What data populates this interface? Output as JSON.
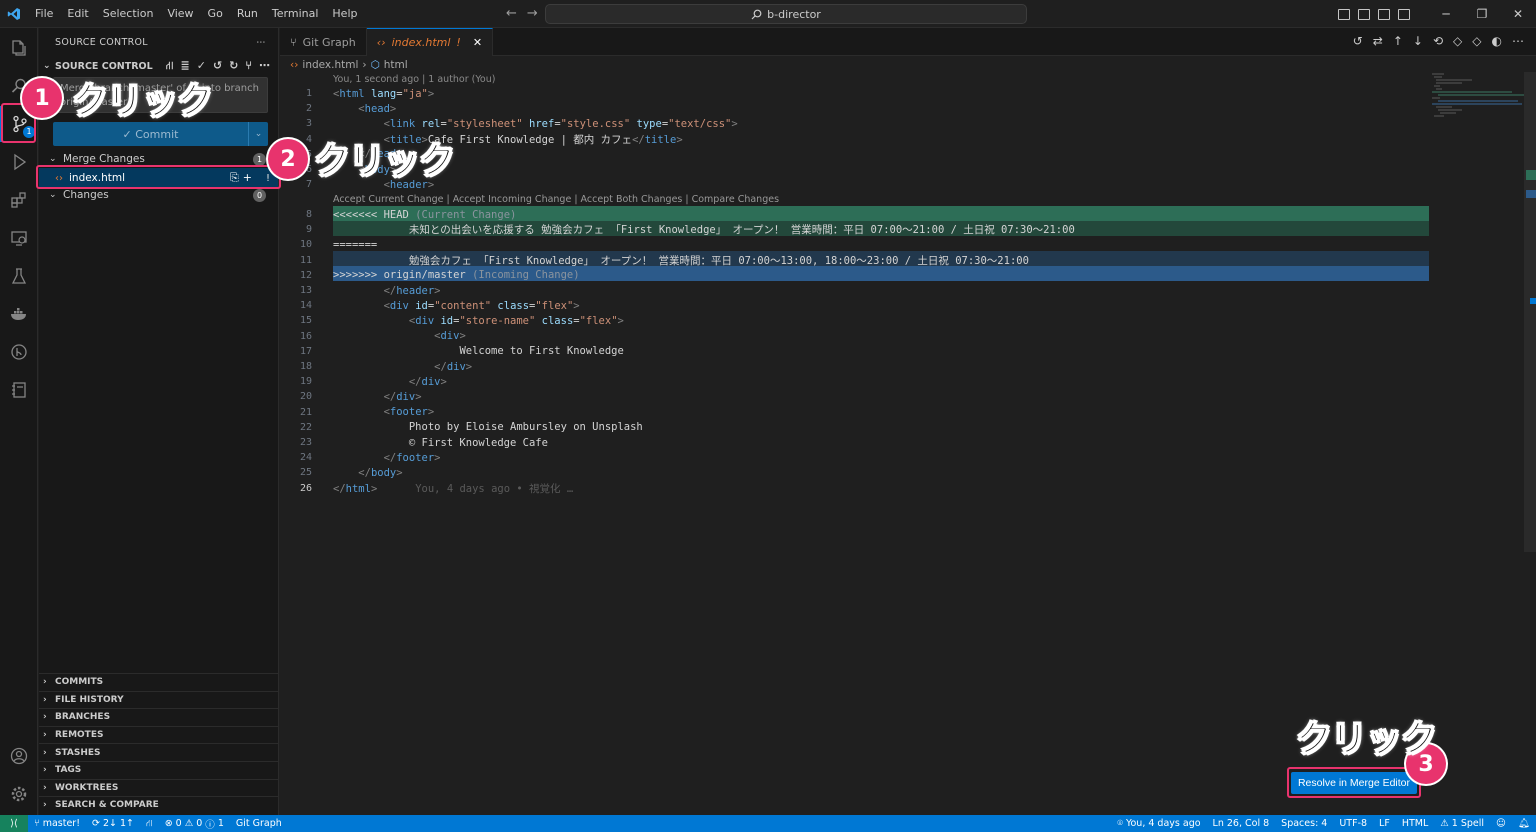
{
  "titlebar": {
    "menu": [
      "File",
      "Edit",
      "Selection",
      "View",
      "Go",
      "Run",
      "Terminal",
      "Help"
    ],
    "search": "b-director"
  },
  "activity_bar": {
    "items": [
      "explorer-icon",
      "search-icon",
      "source-control-icon",
      "run-debug-icon",
      "extensions-icon",
      "remote-explorer-icon",
      "testing-icon",
      "docker-icon",
      "gitlens-icon",
      "notebook-icon"
    ],
    "source_control_badge": "1",
    "bottom": [
      "account-icon",
      "manage-gear-icon"
    ]
  },
  "sidebar": {
    "title": "SOURCE CONTROL",
    "section": "SOURCE CONTROL",
    "message_placeholder_line1": "Merge branch 'master' of ... into branch",
    "message_placeholder_line2": "origin/master",
    "commit_label": "Commit",
    "merge_changes_label": "Merge Changes",
    "merge_changes_count": "1",
    "file_name": "index.html",
    "file_status": "!",
    "changes_label": "Changes",
    "changes_count": "0",
    "panels": [
      "COMMITS",
      "FILE HISTORY",
      "BRANCHES",
      "REMOTES",
      "STASHES",
      "TAGS",
      "WORKTREES",
      "SEARCH & COMPARE"
    ]
  },
  "tabs": [
    {
      "label": "Git Graph"
    },
    {
      "label": "index.html",
      "status": "!"
    }
  ],
  "breadcrumb": {
    "file": "index.html",
    "symbol": "html"
  },
  "blame_header": "You, 1 second ago | 1 author (You)",
  "codelens": "Accept Current Change | Accept Incoming Change | Accept Both Changes | Compare Changes",
  "code": {
    "l1_tag": "html",
    "l1_attr": "lang",
    "l1_val": "\"ja\"",
    "l2": "head",
    "l3_attr1": "rel",
    "l3_val1": "\"stylesheet\"",
    "l3_attr2": "href",
    "l3_val2": "\"style.css\"",
    "l3_attr3": "type",
    "l3_val3": "\"text/css\"",
    "l4_text": "Cafe First Knowledge | 都内 カフェ",
    "l6": "body",
    "l7": "header",
    "l8_marker": "<<<<<<< HEAD",
    "l8_note": "(Current Change)",
    "l9_text": "未知との出会いを応援する 勉強会カフェ 「First Knowledge」 オープン！ 営業時間：平日 07:00〜21:00 / 土日祝 07:30〜21:00",
    "l10": "=======",
    "l11_text": "勉強会カフェ 「First Knowledge」 オープン！ 営業時間：平日 07:00〜13:00, 18:00〜23:00 / 土日祝 07:30〜21:00",
    "l12_marker": ">>>>>>> origin/master",
    "l12_note": "(Incoming Change)",
    "l13": "header",
    "l14_attr1": "id",
    "l14_val1": "\"content\"",
    "l14_attr2": "class",
    "l14_val2": "\"flex\"",
    "l15_attr1": "id",
    "l15_val1": "\"store-name\"",
    "l15_attr2": "class",
    "l15_val2": "\"flex\"",
    "l16": "div",
    "l17_text": "Welcome to First Knowledge",
    "l18": "div",
    "l19": "div",
    "l20": "div",
    "l21": "footer",
    "l22_text": "Photo by Eloise Ambursley on Unsplash",
    "l23_text": "© First Knowledge Cafe",
    "l24": "footer",
    "l25": "body",
    "l26": "html",
    "l26_blame": "You, 4 days ago • 視覚化 …"
  },
  "resolve_button": "Resolve in Merge Editor",
  "statusbar": {
    "branch": "master!",
    "sync": "2↓ 1↑",
    "problems_errors": "0",
    "problems_warnings": "0",
    "problems_info": "1",
    "git_graph": "Git Graph",
    "blame": "You, 4 days ago",
    "position": "Ln 26, Col 8",
    "spaces": "Spaces: 4",
    "encoding": "UTF-8",
    "eol": "LF",
    "language": "HTML",
    "spell": "1 Spell"
  },
  "annotations": {
    "n1": "1",
    "n2": "2",
    "n3": "3",
    "label": "クリック"
  },
  "colors": {
    "accent": "#0078d4",
    "annotation": "#e8336d",
    "current_change": "#2d6e57",
    "incoming_change": "#2c5a8a"
  }
}
